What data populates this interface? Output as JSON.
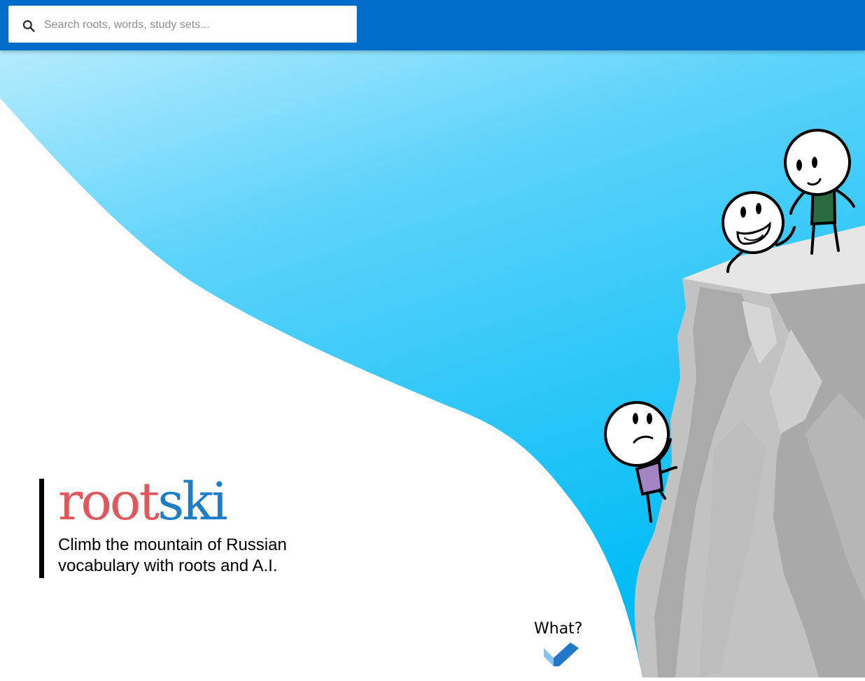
{
  "search": {
    "placeholder": "Search roots, words, study sets..."
  },
  "brand": {
    "logo_part1": "root",
    "logo_part2": "ski",
    "tagline": "Climb the mountain of Russian vocabulary with roots and A.I.",
    "logo_color_1": "#e0575c",
    "logo_color_2": "#1f7cc6"
  },
  "scroll_hint": {
    "label": "What?",
    "icon": "chevron-down-icon"
  },
  "colors": {
    "header": "#006dc9",
    "sky_light": "#a8e8fc",
    "sky_dark": "#00bff7",
    "rock": "#c4c4c4"
  }
}
